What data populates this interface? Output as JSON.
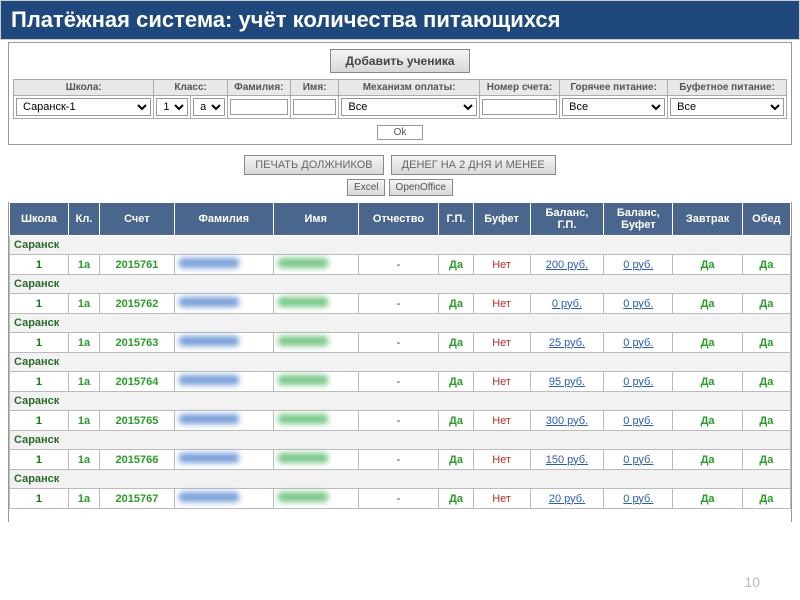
{
  "title": "Платёжная система: учёт количества питающихся",
  "buttons": {
    "add_student": "Добавить ученика",
    "ok": "Ok",
    "print_debtors": "ПЕЧАТЬ ДОЛЖНИКОВ",
    "low_balance": "ДЕНЕГ НА 2 ДНЯ И МЕНЕЕ",
    "excel": "Excel",
    "openoffice": "OpenOffice"
  },
  "filters": {
    "labels": {
      "school": "Школа:",
      "klass": "Класс:",
      "surname": "Фамилия:",
      "name": "Имя:",
      "pay_mech": "Механизм оплаты:",
      "account": "Номер счета:",
      "hot_meal": "Горячее питание:",
      "buffet_meal": "Буфетное питание:"
    },
    "values": {
      "school": "Саранск-1",
      "klass_num": "1",
      "klass_letter": "а",
      "surname": "",
      "name": "",
      "pay_mech": "Все",
      "account": "",
      "hot_meal": "Все",
      "buffet_meal": "Все"
    }
  },
  "table": {
    "headers": {
      "school": "Школа",
      "klass": "Кл.",
      "account": "Счет",
      "surname": "Фамилия",
      "name": "Имя",
      "patronymic": "Отчество",
      "gp": "Г.П.",
      "buffet": "Буфет",
      "balance_gp": "Баланс, Г.П.",
      "balance_buffet": "Баланс, Буфет",
      "breakfast": "Завтрак",
      "lunch": "Обед"
    },
    "group_label": "Саранск",
    "rows": [
      {
        "school": "1",
        "klass": "1а",
        "account": "2015761",
        "patronymic": "-",
        "gp": "Да",
        "buffet": "Нет",
        "bal_gp": "200 руб.",
        "bal_buf": "0 руб.",
        "breakfast": "Да",
        "lunch": "Да"
      },
      {
        "school": "1",
        "klass": "1а",
        "account": "2015762",
        "patronymic": "-",
        "gp": "Да",
        "buffet": "Нет",
        "bal_gp": "0 руб.",
        "bal_buf": "0 руб.",
        "breakfast": "Да",
        "lunch": "Да"
      },
      {
        "school": "1",
        "klass": "1а",
        "account": "2015763",
        "patronymic": "-",
        "gp": "Да",
        "buffet": "Нет",
        "bal_gp": "25 руб.",
        "bal_buf": "0 руб.",
        "breakfast": "Да",
        "lunch": "Да"
      },
      {
        "school": "1",
        "klass": "1а",
        "account": "2015764",
        "patronymic": "-",
        "gp": "Да",
        "buffet": "Нет",
        "bal_gp": "95 руб.",
        "bal_buf": "0 руб.",
        "breakfast": "Да",
        "lunch": "Да"
      },
      {
        "school": "1",
        "klass": "1а",
        "account": "2015765",
        "patronymic": "-",
        "gp": "Да",
        "buffet": "Нет",
        "bal_gp": "300 руб.",
        "bal_buf": "0 руб.",
        "breakfast": "Да",
        "lunch": "Да"
      },
      {
        "school": "1",
        "klass": "1а",
        "account": "2015766",
        "patronymic": "-",
        "gp": "Да",
        "buffet": "Нет",
        "bal_gp": "150 руб.",
        "bal_buf": "0 руб.",
        "breakfast": "Да",
        "lunch": "Да"
      },
      {
        "school": "1",
        "klass": "1а",
        "account": "2015767",
        "patronymic": "-",
        "gp": "Да",
        "buffet": "Нет",
        "bal_gp": "20 руб.",
        "bal_buf": "0 руб.",
        "breakfast": "Да",
        "lunch": "Да"
      }
    ]
  },
  "page_number": "10"
}
